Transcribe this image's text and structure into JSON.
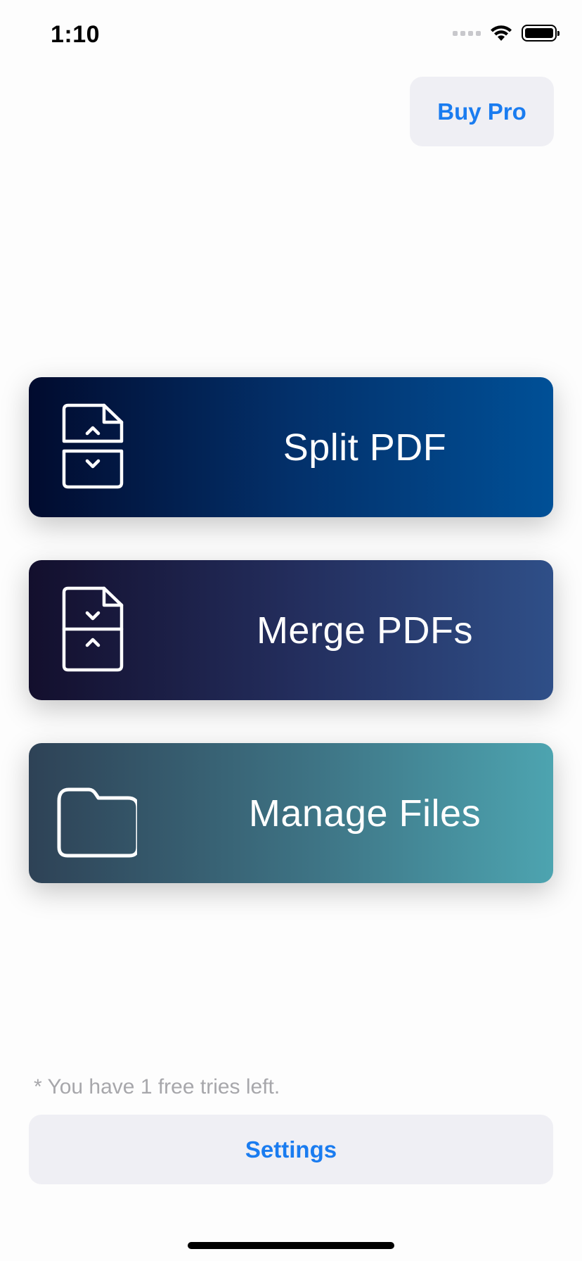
{
  "status_bar": {
    "time": "1:10",
    "icons": [
      "signal-icon",
      "wifi-icon",
      "battery-icon"
    ]
  },
  "header": {
    "buy_pro_label": "Buy Pro"
  },
  "actions": [
    {
      "label": "Split PDF",
      "icon": "split-pdf-icon"
    },
    {
      "label": "Merge PDFs",
      "icon": "merge-pdf-icon"
    },
    {
      "label": "Manage Files",
      "icon": "folder-icon"
    }
  ],
  "footer": {
    "free_tries_note": "* You have 1 free tries left.",
    "settings_label": "Settings"
  },
  "colors": {
    "accent": "#1a7cf0",
    "button_bg": "#efeff4",
    "note_text": "#a7a7ab"
  }
}
